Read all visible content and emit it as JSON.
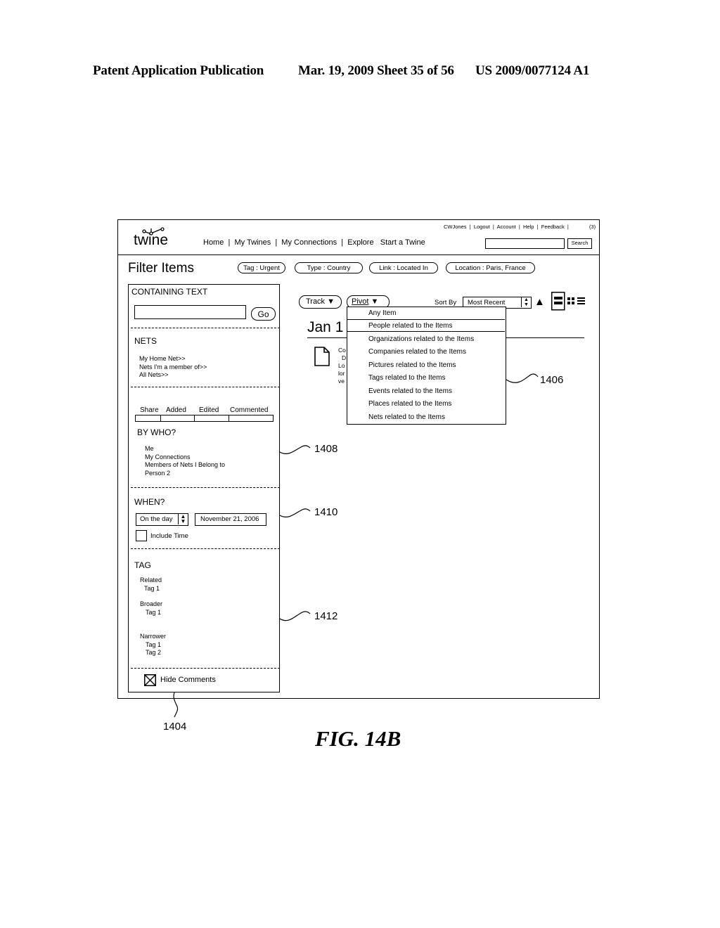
{
  "patent_header": {
    "left": "Patent Application Publication",
    "middle": "Mar. 19, 2009  Sheet 35 of 56",
    "right": "US 2009/0077124 A1"
  },
  "app": {
    "logo": "twine",
    "user_links": [
      "CWJones",
      "Logout",
      "Account",
      "Help",
      "Feedback"
    ],
    "notification_count": "(3)",
    "nav": [
      "Home",
      "My Twines",
      "My Connections",
      "Explore",
      "Start a Twine"
    ],
    "search": {
      "value": "",
      "button": "Search"
    }
  },
  "filter_bar": {
    "title": "Filter Items",
    "chips": [
      "Tag : Urgent",
      "Type : Country",
      "Link : Located In",
      "Location : Paris, France"
    ]
  },
  "sidebar": {
    "containing_text": {
      "label": "CONTAINING TEXT",
      "value": "",
      "go": "Go"
    },
    "nets": {
      "label": "NETS",
      "items": [
        "My Home Net>>",
        "Nets I'm a member of>>",
        "All Nets>>"
      ]
    },
    "activity_tabs": [
      "Share",
      "Added",
      "Edited",
      "Commented"
    ],
    "by_who": {
      "label": "BY WHO?",
      "items": [
        "Me",
        "My Connections",
        "Members of Nets I Belong to",
        "Person 2"
      ]
    },
    "when": {
      "label": "WHEN?",
      "mode": "On the day",
      "date": "November 21, 2006",
      "include_time_label": "Include Time",
      "include_time_checked": false
    },
    "tag": {
      "label": "TAG",
      "groups": [
        {
          "name": "Related",
          "tags": [
            "Tag 1"
          ]
        },
        {
          "name": "Broader",
          "tags": [
            "Tag 1"
          ]
        },
        {
          "name": "Narrower",
          "tags": [
            "Tag 1",
            "Tag 2"
          ]
        }
      ]
    },
    "hide_comments": {
      "label": "Hide Comments",
      "checked": true
    }
  },
  "main": {
    "track_button": "Track",
    "pivot_button": "Pivot",
    "sort_by_label": "Sort By",
    "sort_value": "Most Recent",
    "date_heading": "Jan 1",
    "item_snippet_lines": [
      "Co",
      "D",
      "Lo",
      "lor",
      "ve"
    ],
    "pivot_menu": [
      "Any Item",
      "People related to the Items",
      "Organizations related to the Items",
      "Companies related to the Items",
      "Pictures related to the Items",
      "Tags related to the Items",
      "Events related to the Items",
      "Places related to the Items",
      "Nets related to the Items"
    ],
    "pivot_selected_index": 1
  },
  "reference_numerals": {
    "r1404": "1404",
    "r1406": "1406",
    "r1408": "1408",
    "r1410": "1410",
    "r1412": "1412"
  },
  "figure_label": "FIG. 14B"
}
